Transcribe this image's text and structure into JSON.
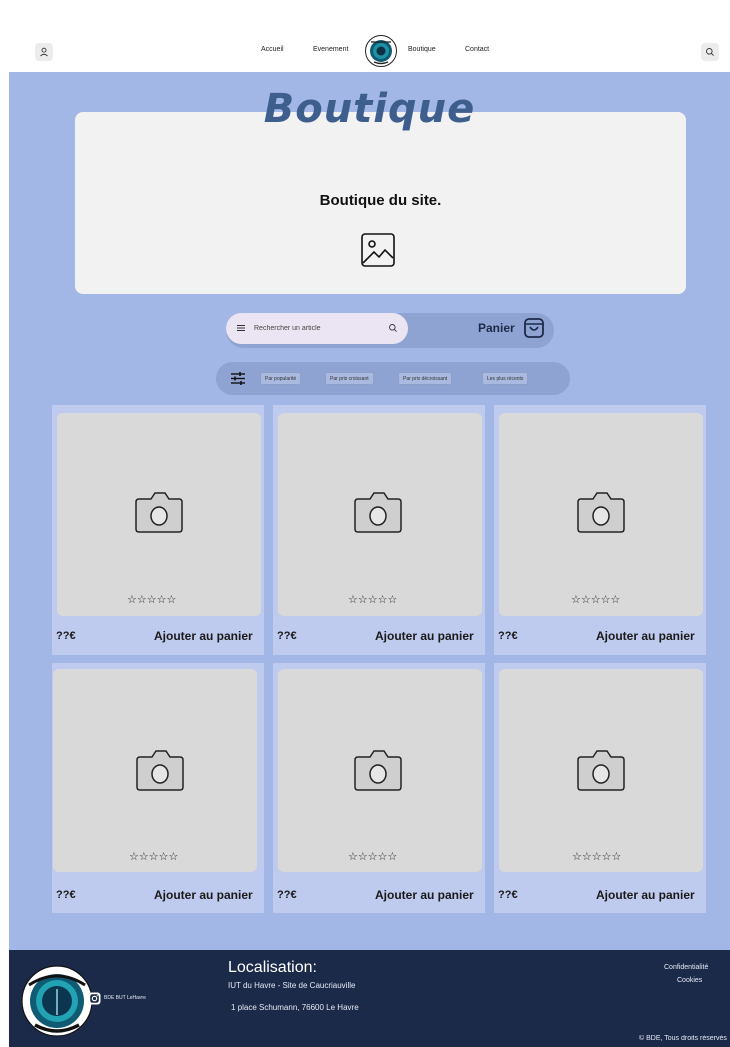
{
  "header": {
    "nav": [
      "Accueil",
      "Evenement",
      "Boutique",
      "Contact"
    ],
    "logo_icon": "bde-logo-icon",
    "user_icon": "user-icon",
    "search_icon": "search-icon"
  },
  "hero": {
    "title": "Boutique",
    "text": "Boutique du site.",
    "image_icon": "image-placeholder-icon"
  },
  "search": {
    "placeholder": "Rechercher un article",
    "panier_label": "Panier"
  },
  "filters": {
    "chips": [
      "Par popularité",
      "Par prix croissant",
      "Par prix décroissant",
      "Les plus récents"
    ]
  },
  "products": [
    {
      "price": "??€",
      "add_label": "Ajouter au panier",
      "stars": "☆☆☆☆☆"
    },
    {
      "price": "??€",
      "add_label": "Ajouter au panier",
      "stars": "☆☆☆☆☆"
    },
    {
      "price": "??€",
      "add_label": "Ajouter au panier",
      "stars": "☆☆☆☆☆"
    },
    {
      "price": "??€",
      "add_label": "Ajouter au panier",
      "stars": "☆☆☆☆☆"
    },
    {
      "price": "??€",
      "add_label": "Ajouter au panier",
      "stars": "☆☆☆☆☆"
    },
    {
      "price": "??€",
      "add_label": "Ajouter au panier",
      "stars": "☆☆☆☆☆"
    }
  ],
  "footer": {
    "instagram_label": "BDE BUT LeHavre",
    "location_title": "Localisation:",
    "location_line1": "IUT du Havre - Site de Caucriauville",
    "location_line2": "1 place Schumann, 76600 Le Havre",
    "links": [
      "Confidentialité",
      "Cookies"
    ],
    "copyright": "© BDE, Tous droits réservés"
  },
  "colors": {
    "main_bg": "#a2b7e6",
    "card_bg": "#bfcbee",
    "footer_bg": "#1c2a4a",
    "title": "#3e5e8e"
  }
}
